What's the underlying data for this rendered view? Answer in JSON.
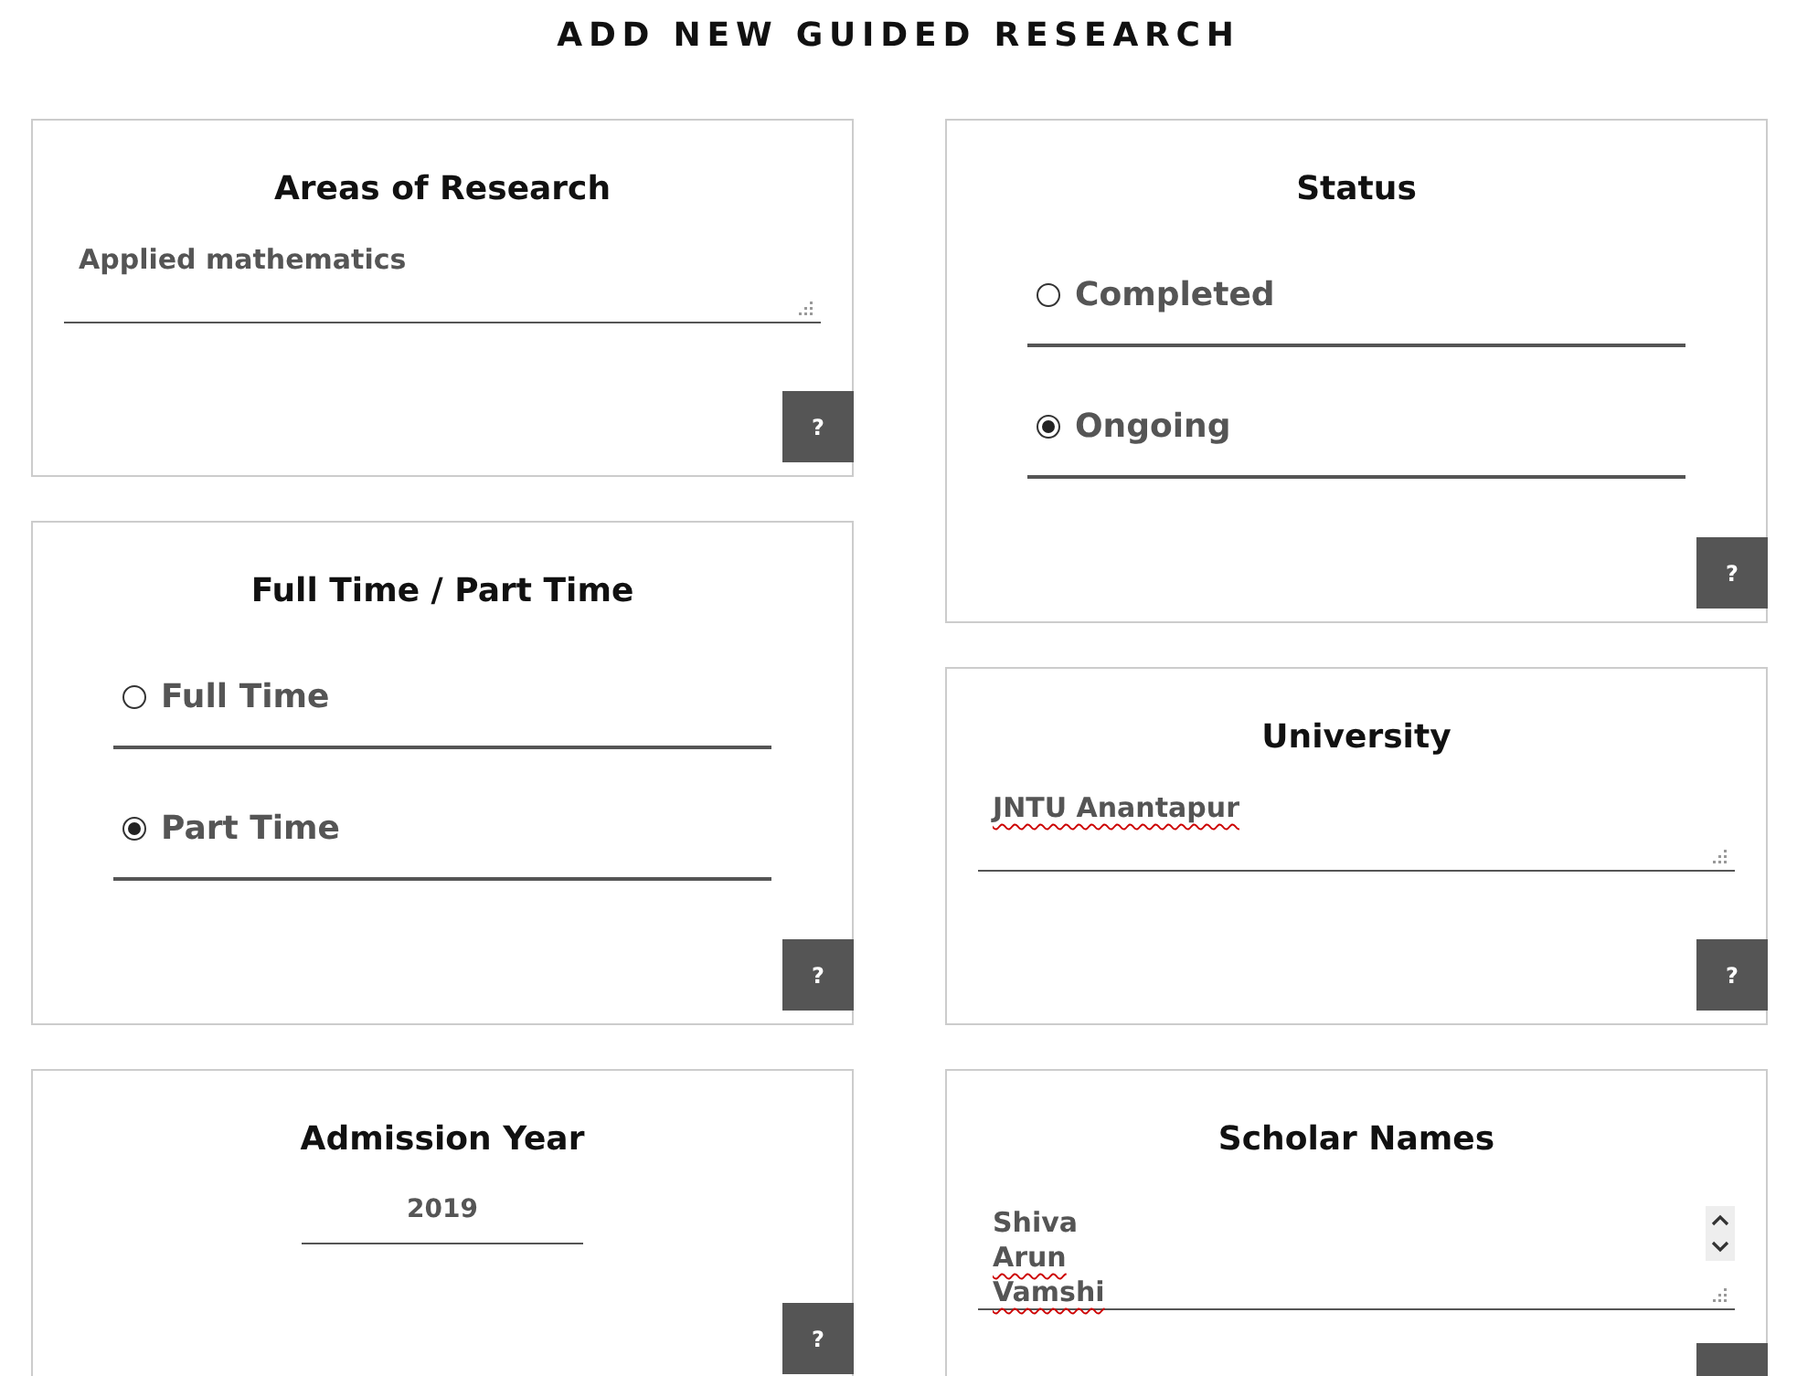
{
  "page_title": "ADD NEW GUIDED RESEARCH",
  "columns": [
    [
      {
        "kind": "text",
        "title": "Areas of Research",
        "value": "Applied mathematics",
        "flagged": false,
        "help": "?"
      },
      {
        "kind": "radio",
        "title": "Full Time / Part Time",
        "options": [
          {
            "label": "Full Time",
            "selected": false
          },
          {
            "label": "Part Time",
            "selected": true
          }
        ],
        "help": "?"
      },
      {
        "kind": "year",
        "title": "Admission Year",
        "value": "2019",
        "help": "?"
      }
    ],
    [
      {
        "kind": "radio",
        "title": "Status",
        "options": [
          {
            "label": "Completed",
            "selected": false
          },
          {
            "label": "Ongoing",
            "selected": true
          }
        ],
        "help": "?"
      },
      {
        "kind": "text",
        "title": "University",
        "value": "JNTU Anantapur",
        "flagged": true,
        "help": "?"
      },
      {
        "kind": "list",
        "title": "Scholar Names",
        "lines": [
          {
            "text": "Shiva",
            "flagged": false
          },
          {
            "text": "Arun",
            "flagged": true
          },
          {
            "text": "Vamshi",
            "flagged": true
          }
        ],
        "help_button": true
      }
    ]
  ]
}
